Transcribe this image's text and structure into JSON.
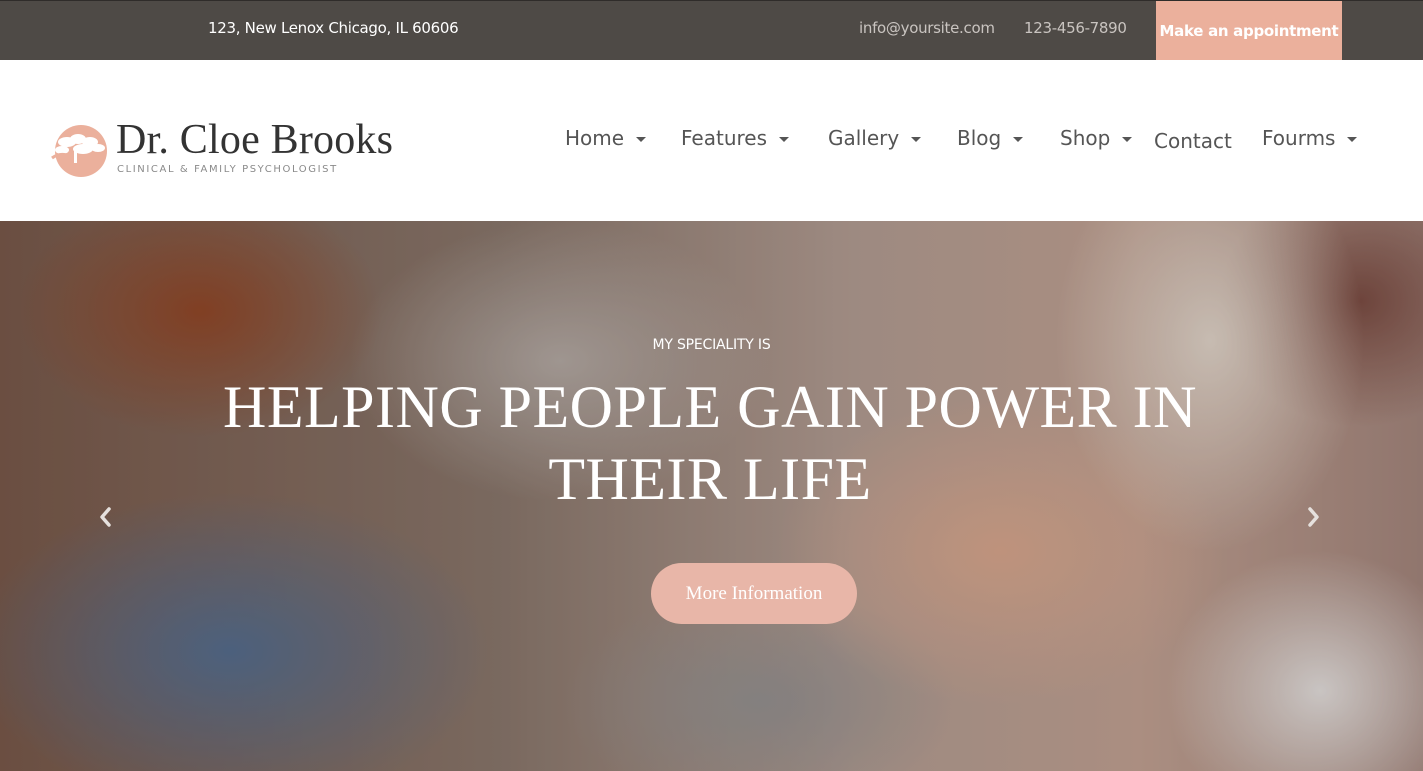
{
  "topbar": {
    "address": "123, New Lenox Chicago, IL 60606",
    "email": "info@yoursite.com",
    "phone": "123-456-7890",
    "appointment_label": "Make an appointment"
  },
  "brand": {
    "name": "Dr. Cloe Brooks",
    "tagline": "CLINICAL & FAMILY PSYCHOLOGIST",
    "logo_icon": "tree-circle-logo"
  },
  "nav": {
    "items": [
      {
        "label": "Home",
        "has_dropdown": true
      },
      {
        "label": "Features",
        "has_dropdown": true
      },
      {
        "label": "Gallery",
        "has_dropdown": true
      },
      {
        "label": "Blog",
        "has_dropdown": true
      },
      {
        "label": "Shop",
        "has_dropdown": true
      },
      {
        "label": "Contact",
        "has_dropdown": false
      },
      {
        "label": "Fourms",
        "has_dropdown": true
      }
    ]
  },
  "hero": {
    "kicker": "MY SPECIALITY IS",
    "headline_line1": "HELPING PEOPLE GAIN POWER IN",
    "headline_line2": "THEIR LIFE",
    "cta_label": "More Information",
    "prev_icon": "chevron-left-icon",
    "next_icon": "chevron-right-icon"
  },
  "colors": {
    "topbar_bg": "#4e4a46",
    "accent": "#ebb09c",
    "cta_bg": "#e8b6a8",
    "nav_text": "#555555",
    "brand_text": "#333333"
  }
}
